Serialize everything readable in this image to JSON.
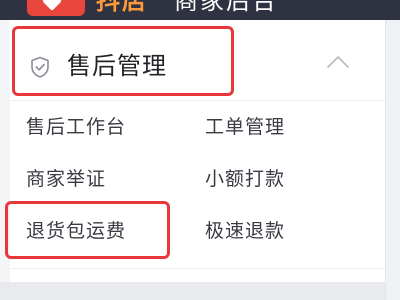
{
  "header": {
    "brand": "抖店",
    "platform": "商家后台"
  },
  "section": {
    "title": "售后管理",
    "icon": "shield-icon",
    "collapse_icon": "chevron-up-icon"
  },
  "menu": {
    "items": [
      {
        "label": "售后工作台"
      },
      {
        "label": "工单管理"
      },
      {
        "label": "商家举证"
      },
      {
        "label": "小额打款"
      },
      {
        "label": "退货包运费"
      },
      {
        "label": "极速退款"
      }
    ]
  },
  "colors": {
    "header_bg": "#2f3240",
    "brand_accent": "#e8453c",
    "highlight": "#e8373a",
    "text_primary": "#222327",
    "text_menu": "#3a3c44"
  }
}
